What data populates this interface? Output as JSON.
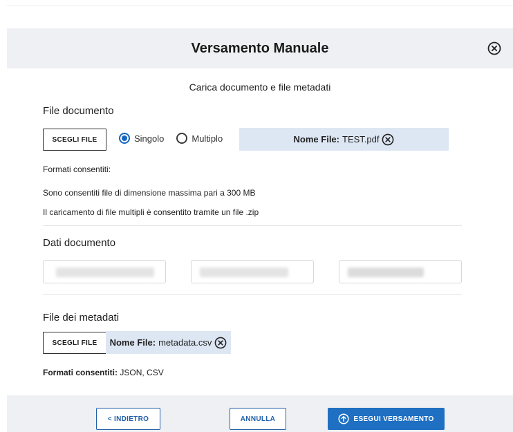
{
  "modal": {
    "title": "Versamento Manuale",
    "subtitle": "Carica documento e file metadati"
  },
  "file_documento": {
    "title": "File documento",
    "choose_label": "SCEGLI FILE",
    "radio_options": [
      {
        "label": "Singolo",
        "checked": true
      },
      {
        "label": "Multiplo",
        "checked": false
      }
    ],
    "file_name_label": "Nome File:",
    "file_name": "TEST.pdf",
    "formats_label": "Formati consentiti:",
    "size_note": "Sono consentiti file di dimensione massima pari a 300 MB",
    "multi_note": "Il caricamento di file multipli è consentito tramite un file .zip"
  },
  "dati_documento": {
    "title": "Dati documento"
  },
  "file_metadati": {
    "title": "File dei metadati",
    "choose_label": "SCEGLI FILE",
    "file_name_label": "Nome File:",
    "file_name": "metadata.csv",
    "formats_label": "Formati consentiti:",
    "formats_value": "JSON, CSV"
  },
  "footer": {
    "back_label": "< INDIETRO",
    "cancel_label": "ANNULLA",
    "submit_label": "ESEGUI VERSAMENTO"
  },
  "colors": {
    "accent": "#1f6fc2",
    "chip_bg": "#dde7f3",
    "header_bg": "#eef0f3"
  }
}
